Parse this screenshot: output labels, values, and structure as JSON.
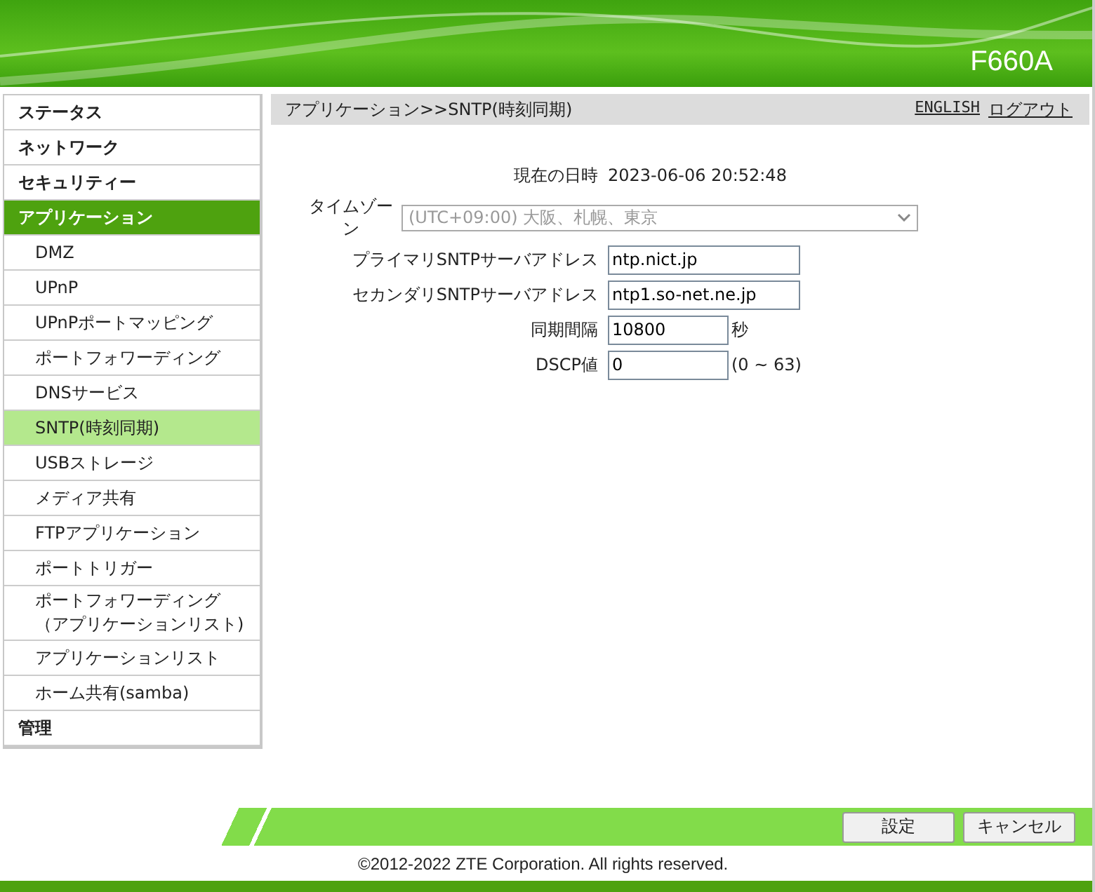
{
  "header": {
    "model": "F660A"
  },
  "sidebar": {
    "items": [
      {
        "label": "ステータス",
        "selected": false
      },
      {
        "label": "ネットワーク",
        "selected": false
      },
      {
        "label": "セキュリティー",
        "selected": false
      },
      {
        "label": "アプリケーション",
        "selected": true,
        "children": [
          {
            "label": "DMZ",
            "selected": false
          },
          {
            "label": "UPnP",
            "selected": false
          },
          {
            "label": "UPnPポートマッピング",
            "selected": false
          },
          {
            "label": "ポートフォワーディング",
            "selected": false
          },
          {
            "label": "DNSサービス",
            "selected": false
          },
          {
            "label": "SNTP(時刻同期)",
            "selected": true
          },
          {
            "label": "USBストレージ",
            "selected": false
          },
          {
            "label": "メディア共有",
            "selected": false
          },
          {
            "label": "FTPアプリケーション",
            "selected": false
          },
          {
            "label": "ポートトリガー",
            "selected": false
          },
          {
            "label": "ポートフォワーディング（アプリケーションリスト)",
            "selected": false
          },
          {
            "label": "アプリケーションリスト",
            "selected": false
          },
          {
            "label": "ホーム共有(samba)",
            "selected": false
          }
        ]
      },
      {
        "label": "管理",
        "selected": false
      }
    ]
  },
  "breadcrumb": "アプリケーション>>SNTP(時刻同期)",
  "links": [
    "ENGLISH",
    "ログアウト"
  ],
  "form": [
    {
      "kind": "text",
      "label": "現在の日時",
      "value": "2023-06-06 20:52:48"
    },
    {
      "kind": "select",
      "label": "タイムゾーン",
      "value": "(UTC+09:00) 大阪、札幌、東京",
      "disabled": true
    },
    {
      "kind": "input",
      "label": "プライマリSNTPサーバアドレス",
      "value": "ntp.nict.jp"
    },
    {
      "kind": "input",
      "label": "セカンダリSNTPサーバアドレス",
      "value": "ntp1.so-net.ne.jp"
    },
    {
      "kind": "short",
      "label": "同期間隔",
      "value": "10800",
      "unit": "秒"
    },
    {
      "kind": "short",
      "label": "DSCP値",
      "value": "0",
      "unit": "(0 ~ 63)"
    }
  ],
  "buttons": [
    "設定",
    "キャンセル"
  ],
  "footer": "©2012-2022 ZTE Corporation. All rights reserved."
}
